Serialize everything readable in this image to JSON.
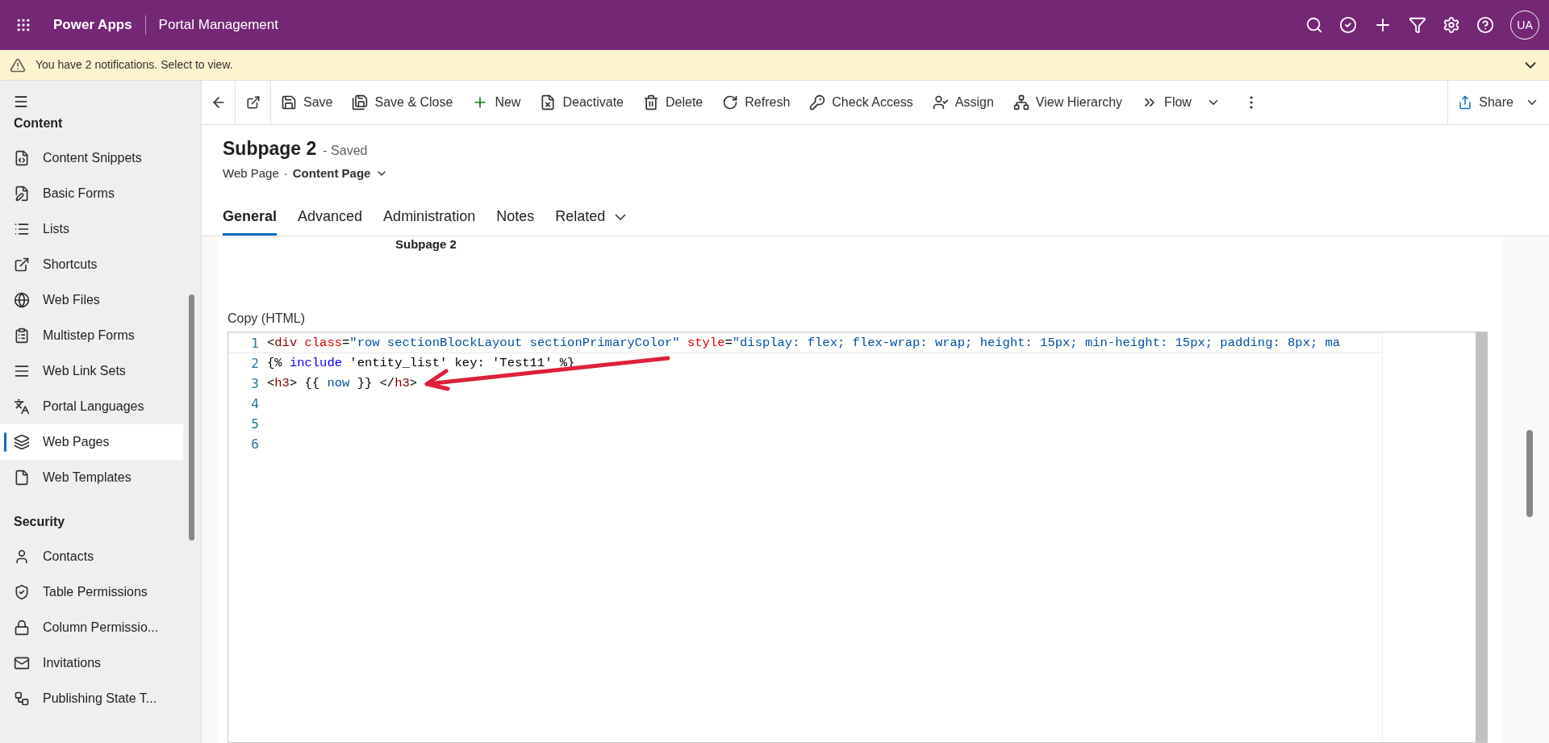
{
  "app_bar": {
    "app_name": "Power Apps",
    "environment": "Portal Management",
    "avatar": "UA"
  },
  "notification": {
    "text": "You have 2 notifications. Select to view."
  },
  "toolbar": {
    "items": [
      {
        "label": "Save",
        "dropdown": false
      },
      {
        "label": "Save & Close",
        "dropdown": false
      },
      {
        "label": "New",
        "dropdown": false
      },
      {
        "label": "Deactivate",
        "dropdown": false
      },
      {
        "label": "Delete",
        "dropdown": false
      },
      {
        "label": "Refresh",
        "dropdown": false
      },
      {
        "label": "Check Access",
        "dropdown": false
      },
      {
        "label": "Assign",
        "dropdown": false
      },
      {
        "label": "View Hierarchy",
        "dropdown": false
      },
      {
        "label": "Flow",
        "dropdown": true
      }
    ],
    "share": "Share"
  },
  "sidebar": {
    "sections": [
      {
        "title": "Content",
        "items": [
          {
            "label": "Content Snippets",
            "selected": false
          },
          {
            "label": "Basic Forms",
            "selected": false
          },
          {
            "label": "Lists",
            "selected": false
          },
          {
            "label": "Shortcuts",
            "selected": false
          },
          {
            "label": "Web Files",
            "selected": false
          },
          {
            "label": "Multistep Forms",
            "selected": false
          },
          {
            "label": "Web Link Sets",
            "selected": false
          },
          {
            "label": "Portal Languages",
            "selected": false
          },
          {
            "label": "Web Pages",
            "selected": true
          },
          {
            "label": "Web Templates",
            "selected": false
          }
        ]
      },
      {
        "title": "Security",
        "items": [
          {
            "label": "Contacts",
            "selected": false
          },
          {
            "label": "Table Permissions",
            "selected": false
          },
          {
            "label": "Column Permissio...",
            "selected": false
          },
          {
            "label": "Invitations",
            "selected": false
          },
          {
            "label": "Publishing State T...",
            "selected": false
          }
        ]
      }
    ]
  },
  "record": {
    "title": "Subpage 2",
    "status": "- Saved",
    "entity": "Web Page",
    "separator": "·",
    "form": "Content Page"
  },
  "tabs": [
    {
      "label": "General",
      "selected": true,
      "dropdown": false
    },
    {
      "label": "Advanced",
      "selected": false,
      "dropdown": false
    },
    {
      "label": "Administration",
      "selected": false,
      "dropdown": false
    },
    {
      "label": "Notes",
      "selected": false,
      "dropdown": false
    },
    {
      "label": "Related",
      "selected": false,
      "dropdown": true
    }
  ],
  "form": {
    "partial_value": "Subpage 2",
    "field_label": "Copy (HTML)",
    "code_lines": [
      {
        "number": "1",
        "tokens": [
          {
            "kind": "plain",
            "text": "<"
          },
          {
            "kind": "tag",
            "text": "div"
          },
          {
            "kind": "attr",
            "text": " class"
          },
          {
            "kind": "plain",
            "text": "="
          },
          {
            "kind": "value",
            "text": "\"row sectionBlockLayout sectionPrimaryColor\""
          },
          {
            "kind": "attr",
            "text": " style"
          },
          {
            "kind": "plain",
            "text": "="
          },
          {
            "kind": "value",
            "text": "\"display: flex; flex-wrap: wrap; height: 15px; min-height: 15px; padding: 8px; ma"
          }
        ]
      },
      {
        "number": "2",
        "tokens": [
          {
            "kind": "plain",
            "text": "{% "
          },
          {
            "kind": "keyword",
            "text": "include"
          },
          {
            "kind": "plain",
            "text": " 'entity_list' key: 'Test11' %}"
          }
        ]
      },
      {
        "number": "3",
        "tokens": [
          {
            "kind": "plain",
            "text": "<"
          },
          {
            "kind": "tag",
            "text": "h3"
          },
          {
            "kind": "plain",
            "text": "> {{ "
          },
          {
            "kind": "value",
            "text": "now"
          },
          {
            "kind": "plain",
            "text": " }} </"
          },
          {
            "kind": "tag",
            "text": "h3"
          },
          {
            "kind": "plain",
            "text": ">"
          }
        ]
      },
      {
        "number": "4"
      },
      {
        "number": "5"
      },
      {
        "number": "6"
      }
    ]
  }
}
